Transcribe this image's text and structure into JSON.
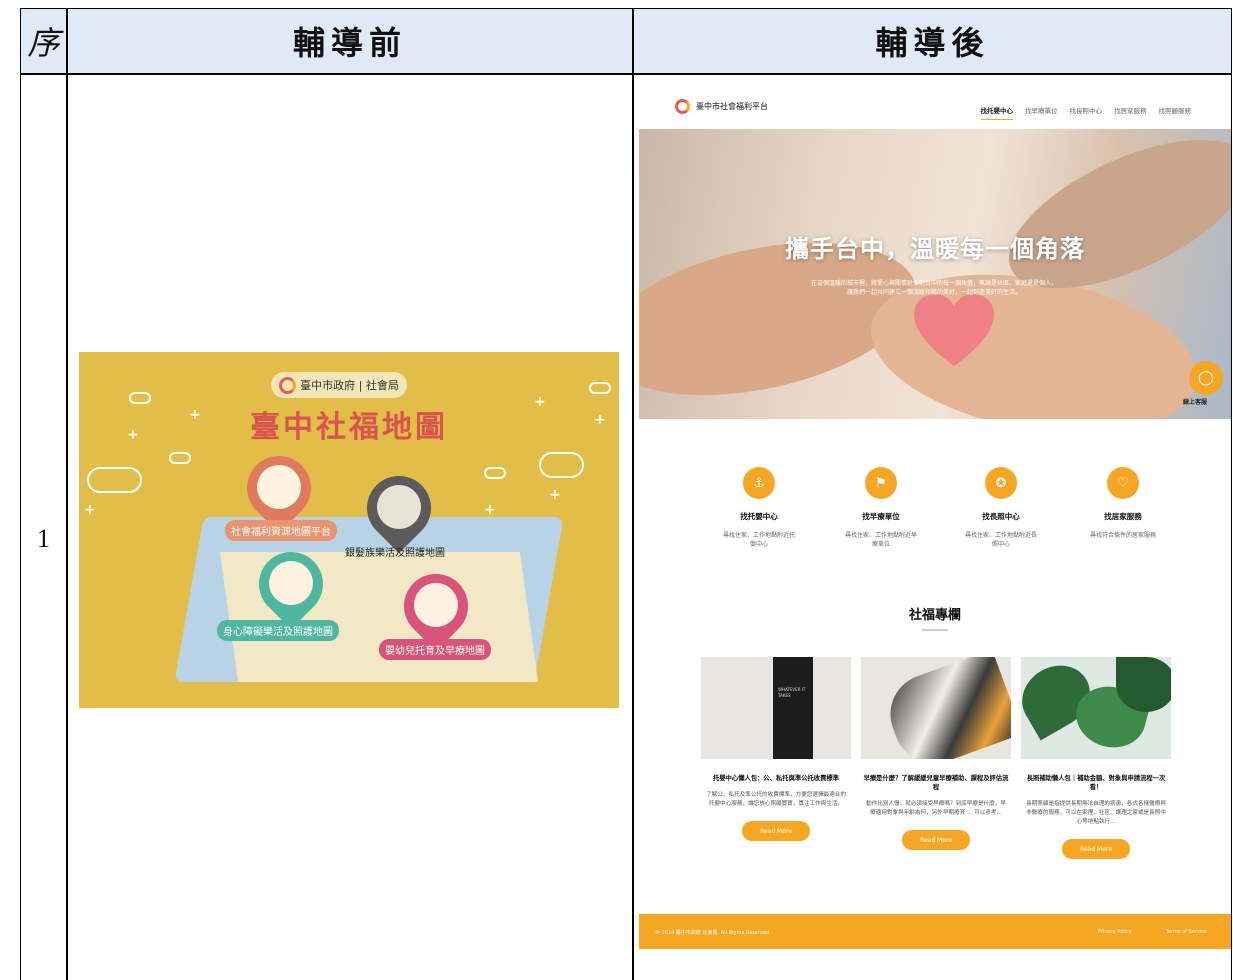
{
  "table": {
    "headers": {
      "seq": "序",
      "before": "輔導前",
      "after": "輔導後"
    },
    "row_number": "1"
  },
  "before_image": {
    "gov_label": "臺中市政府 | 社會局",
    "title": "臺中社福地圖",
    "pins": [
      {
        "label": "社會福利資源地圖平台",
        "color": "#e07a5f"
      },
      {
        "label": "銀髮族樂活及照護地圖",
        "color": "#5b5b5b"
      },
      {
        "label": "身心障礙樂活及照護地圖",
        "color": "#4fb6a0"
      },
      {
        "label": "嬰幼兒托育及早療地圖",
        "color": "#d9537a"
      }
    ]
  },
  "after_image": {
    "brand": "臺中市社會福利平台",
    "nav": [
      "找托嬰中心",
      "找早療單位",
      "找長照中心",
      "找居家服務",
      "找照顧服務"
    ],
    "hero": {
      "title": "攜手台中，溫暖每一個角落",
      "subtitle": "在這個溫暖的城市裡，將愛心與關懷延伸到台中的每一個角落，無論是社區、家庭還是個人，讓我們一起共同建立一個溫暖和諧的美好，一起創造美好的生活。"
    },
    "chat_label": "線上客服",
    "services": [
      {
        "icon": "anchor-icon",
        "title": "找托嬰中心",
        "desc": "尋找住家、工作地點附近托嬰中心"
      },
      {
        "icon": "flag-icon",
        "title": "找早療單位",
        "desc": "尋找住家、工作地點附近早療單位"
      },
      {
        "icon": "award-icon",
        "title": "找長照中心",
        "desc": "尋找住家、工作地點附近長照中心"
      },
      {
        "icon": "heart-icon",
        "title": "找居家服務",
        "desc": "尋找符合條件的居家服務"
      }
    ],
    "section_title": "社福專欄",
    "cards": [
      {
        "img_text": "WHATEVER IT TAKES",
        "title": "托嬰中心懶人包：公、私托與準公托收費標準",
        "desc": "了解公、私托及準公托的收費標準，方便您選擇最適合的托嬰中心服務，讓您放心照顧寶寶，專注工作與生活。",
        "button": "Read More"
      },
      {
        "title": "早療是什麼？了解緩緩兒童早療補助、課程及評估流程",
        "desc": "動作比別人慢，就必須接受早療嗎？到底早療是什麼，早療適用對象與年齡為何，另外早期療育 ... 可以參考...",
        "button": "Read More"
      },
      {
        "title": "長照補助懶人包｜補助金額、對象與申請流程一次看！",
        "desc": "長期照顧是指提供長期無法自理的病患，各式各樣醫療與非醫療的服務，可以在家裡、社區、護理之家或是長照中心等地點執行...",
        "button": "Read More"
      }
    ],
    "footer": {
      "copyright": "© 2024 臺中市政府 社會局. All Rights Reserved.",
      "links": [
        "Privacy Policy",
        "Terms of Service"
      ]
    }
  }
}
